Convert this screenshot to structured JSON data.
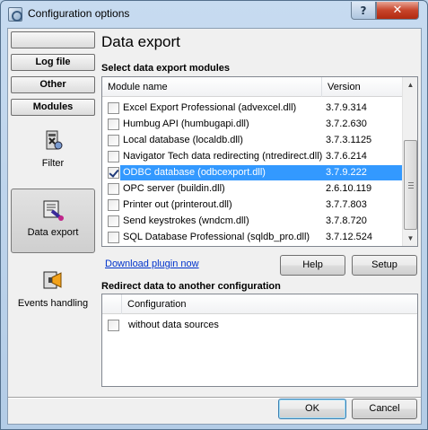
{
  "window": {
    "title": "Configuration options",
    "help_label": "?",
    "close_label": "✕"
  },
  "nav": {
    "text_buttons": [
      "",
      "Log file",
      "Other",
      "Modules"
    ],
    "items": [
      {
        "label": "Filter",
        "icon": "filter-icon"
      },
      {
        "label": "Data export",
        "icon": "data-export-icon",
        "active": true
      },
      {
        "label": "Events handling",
        "icon": "events-handling-icon"
      }
    ]
  },
  "panel": {
    "title": "Data export",
    "modules_section": "Select data export modules",
    "columns": {
      "name": "Module name",
      "version": "Version"
    },
    "modules": [
      {
        "name": "Excel Export Professional (advexcel.dll)",
        "version": "3.7.9.314",
        "checked": false
      },
      {
        "name": "Humbug API (humbugapi.dll)",
        "version": "3.7.2.630",
        "checked": false
      },
      {
        "name": "Local database (localdb.dll)",
        "version": "3.7.3.1125",
        "checked": false
      },
      {
        "name": "Navigator Tech data redirecting (ntredirect.dll)",
        "version": "3.7.6.214",
        "checked": false
      },
      {
        "name": "ODBC database (odbcexport.dll)",
        "version": "3.7.9.222",
        "checked": true,
        "selected": true
      },
      {
        "name": "OPC server (buildin.dll)",
        "version": "2.6.10.119",
        "checked": false
      },
      {
        "name": "Printer out (printerout.dll)",
        "version": "3.7.7.803",
        "checked": false
      },
      {
        "name": "Send keystrokes (wndcm.dll)",
        "version": "3.7.8.720",
        "checked": false
      },
      {
        "name": "SQL Database Professional (sqldb_pro.dll)",
        "version": "3.7.12.524",
        "checked": false
      }
    ],
    "download_link": "Download plugin now",
    "help_button": "Help",
    "setup_button": "Setup",
    "redirect_section": "Redirect data to another configuration",
    "redirect_column": "Configuration",
    "redirect_rows": [
      {
        "name": "without data sources",
        "checked": false
      }
    ]
  },
  "footer": {
    "ok_label": "OK",
    "cancel_label": "Cancel"
  },
  "colors": {
    "selection": "#3399ff",
    "link": "#0033cc",
    "close": "#c7442a"
  }
}
